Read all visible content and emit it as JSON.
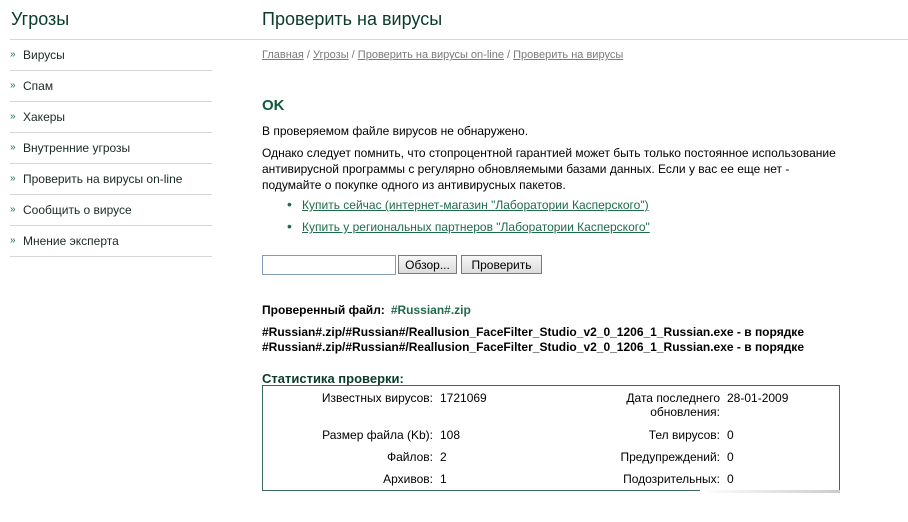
{
  "sidebar": {
    "title": "Угрозы",
    "items": [
      {
        "label": "Вирусы"
      },
      {
        "label": "Спам"
      },
      {
        "label": "Хакеры"
      },
      {
        "label": "Внутренние угрозы"
      },
      {
        "label": "Проверить на вирусы on-line"
      },
      {
        "label": "Сообщить о вирусе"
      },
      {
        "label": "Мнение эксперта"
      }
    ]
  },
  "main": {
    "title": "Проверить на вирусы",
    "breadcrumb": [
      "Главная",
      "Угрозы",
      "Проверить на вирусы on-line",
      "Проверить на вирусы"
    ],
    "breadcrumb_sep": " / ",
    "status": "OK",
    "message": "В проверяемом файле вирусов не обнаружено.",
    "note": "Однако следует помнить, что стопроцентной гарантией может быть только постоянное использование антивирусной программы с регулярно обновляемыми базами данных. Если у вас ее еще нет - подумайте о покупке одного из антивирусных пакетов.",
    "links": [
      "Купить сейчас (интернет-магазин \"Лаборатории Касперского\")",
      "Купить у региональных партнеров \"Лаборатории Касперского\""
    ],
    "browse_label": "Обзор...",
    "check_label": "Проверить",
    "checked_file_label": "Проверенный файл:",
    "checked_file_name": "#Russian#.zip",
    "results": [
      "#Russian#.zip/#Russian#/Reallusion_FaceFilter_Studio_v2_0_1206_1_Russian.exe - в порядке",
      "#Russian#.zip/#Russian#/Reallusion_FaceFilter_Studio_v2_0_1206_1_Russian.exe - в порядке"
    ],
    "stats_title": "Статистика проверки:",
    "stats": {
      "known_viruses_label": "Известных вирусов:",
      "known_viruses": "1721069",
      "last_update_label": "Дата последнего обновления:",
      "last_update": "28-01-2009",
      "file_size_label": "Размер файла (Kb):",
      "file_size": "108",
      "bodies_label": "Тел вирусов:",
      "bodies": "0",
      "files_label": "Файлов:",
      "files": "2",
      "warnings_label": "Предупреждений:",
      "warnings": "0",
      "archives_label": "Архивов:",
      "archives": "1",
      "suspicious_label": "Подозрительных:",
      "suspicious": "0"
    }
  }
}
